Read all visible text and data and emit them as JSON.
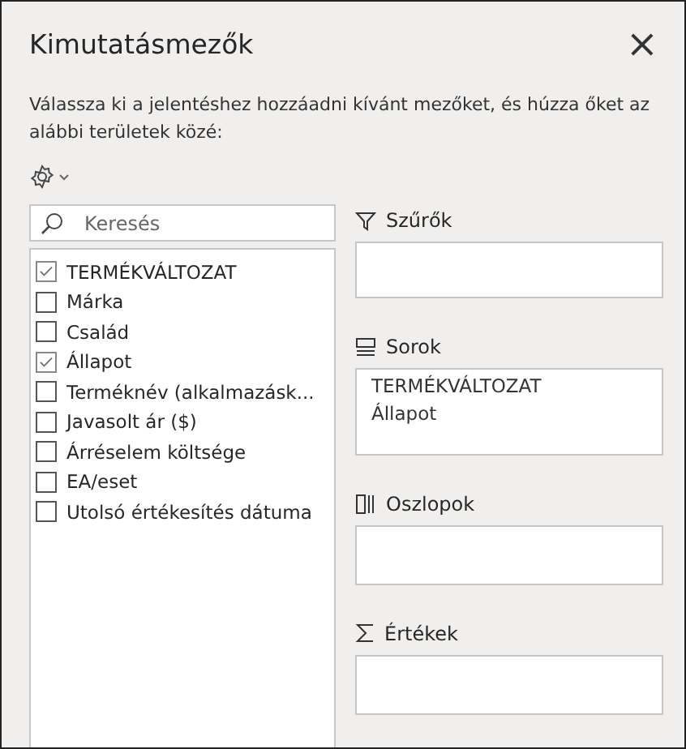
{
  "title": "Kimutatásmezők",
  "close": "×",
  "description": "Válassza ki a jelentéshez hozzáadni kívánt mezőket, és húzza őket az alábbi területek közé:",
  "search": {
    "placeholder": "Keresés"
  },
  "fields": [
    {
      "label": "TERMÉKVÁLTOZAT",
      "checked": true
    },
    {
      "label": "Márka",
      "checked": false
    },
    {
      "label": "Család",
      "checked": false
    },
    {
      "label": "Állapot",
      "checked": true
    },
    {
      "label": "Terméknév (alkalmazásk...",
      "checked": false
    },
    {
      "label": "Javasolt ár ($)",
      "checked": false
    },
    {
      "label": "Árréselem költsége",
      "checked": false
    },
    {
      "label": "EA/eset",
      "checked": false
    },
    {
      "label": "Utolsó értékesítés dátuma",
      "checked": false
    }
  ],
  "areas": [
    {
      "kind": "filters",
      "label": "Szűrők"
    },
    {
      "kind": "rows",
      "label": "Sorok",
      "items": [
        "TERMÉKVÁLTOZAT",
        "Állapot"
      ]
    },
    {
      "kind": "columns",
      "label": "Oszlopok"
    },
    {
      "kind": "values",
      "label": "Értékek"
    }
  ]
}
